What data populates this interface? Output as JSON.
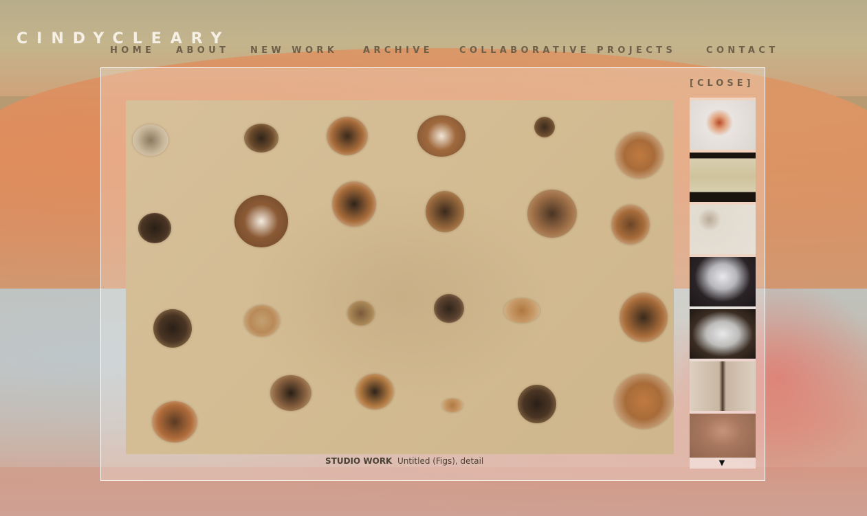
{
  "site": {
    "logo": "CINDYCLEARY"
  },
  "nav": {
    "items": [
      {
        "label": "HOME"
      },
      {
        "label": "ABOUT"
      },
      {
        "label": "NEW WORK"
      },
      {
        "label": "ARCHIVE"
      },
      {
        "label": "COLLABORATIVE PROJECTS"
      },
      {
        "label": "CONTACT"
      }
    ]
  },
  "lightbox": {
    "close_label": "[CLOSE]",
    "caption": {
      "category": "STUDIO WORK",
      "title": "Untitled (Figs), detail"
    },
    "thumbnails": [
      {
        "icon": "artwork-thumbnail"
      },
      {
        "icon": "artwork-thumbnail"
      },
      {
        "icon": "artwork-thumbnail"
      },
      {
        "icon": "artwork-thumbnail"
      },
      {
        "icon": "artwork-thumbnail"
      },
      {
        "icon": "artwork-thumbnail"
      },
      {
        "icon": "artwork-thumbnail"
      }
    ],
    "scroll_icon": "triangle-down-icon"
  },
  "colors": {
    "logo": "#f5efe5",
    "nav": "#6e5f48",
    "caption": "#4c4136"
  }
}
